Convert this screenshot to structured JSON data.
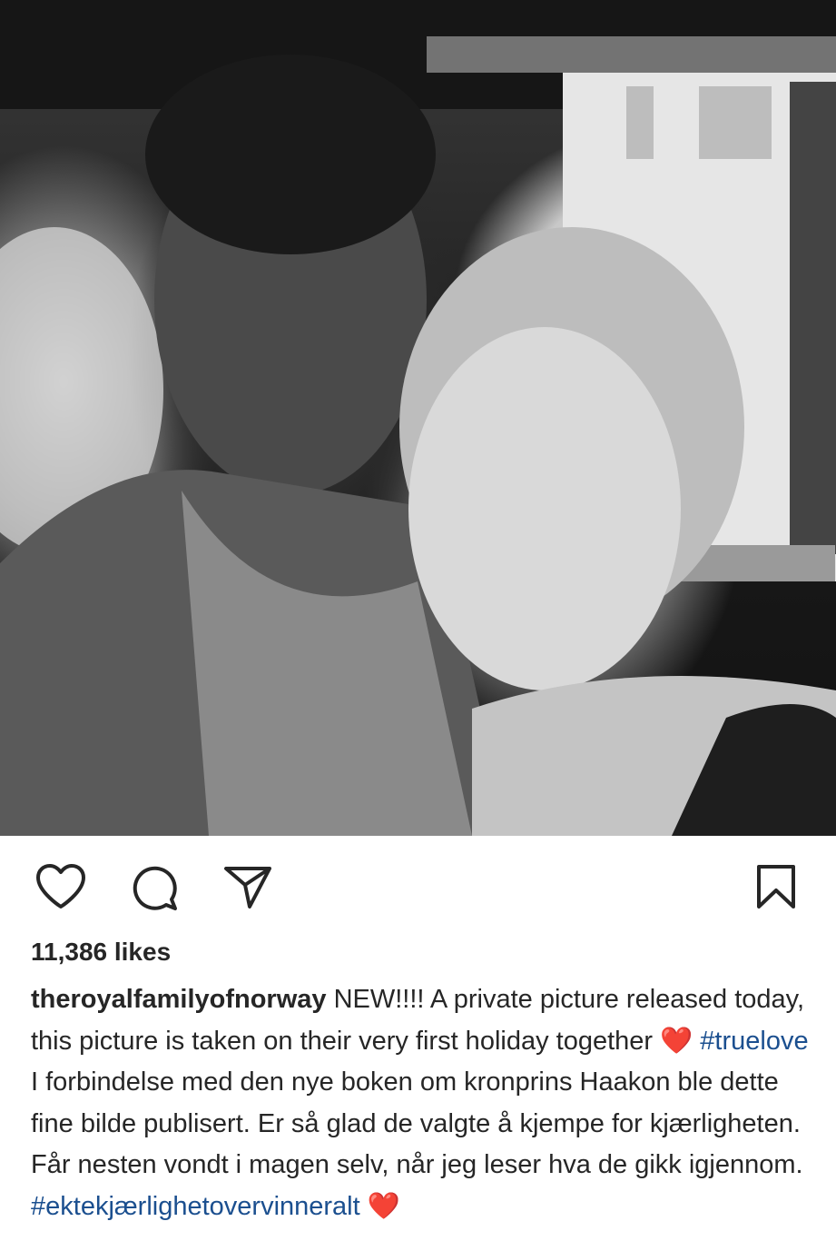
{
  "post": {
    "image_alt": "Black and white photo of a couple"
  },
  "actions": {
    "like_icon": "heart-outline-icon",
    "comment_icon": "comment-bubble-icon",
    "share_icon": "paper-plane-icon",
    "save_icon": "bookmark-outline-icon"
  },
  "likes": "11,386 likes",
  "caption": {
    "username": "theroyalfamilyofnorway",
    "text_1": " NEW!!!! A private picture released today, this picture is taken on their very first holiday together ",
    "heart_1": "❤️",
    "tag_1": "#truelove",
    "text_2": " I forbindelse med den nye boken om kronprins Haakon ble dette fine bilde publisert. Er så glad de valgte å kjempe for kjærligheten. Får nesten vondt i magen selv, når jeg leser hva de gikk igjennom. ",
    "tag_2": "#ektekjærlighetovervinneralt",
    "heart_2": "❤️"
  },
  "colors": {
    "text": "#262626",
    "hashtag": "#1b4f8f",
    "heart": "#e0212f"
  }
}
